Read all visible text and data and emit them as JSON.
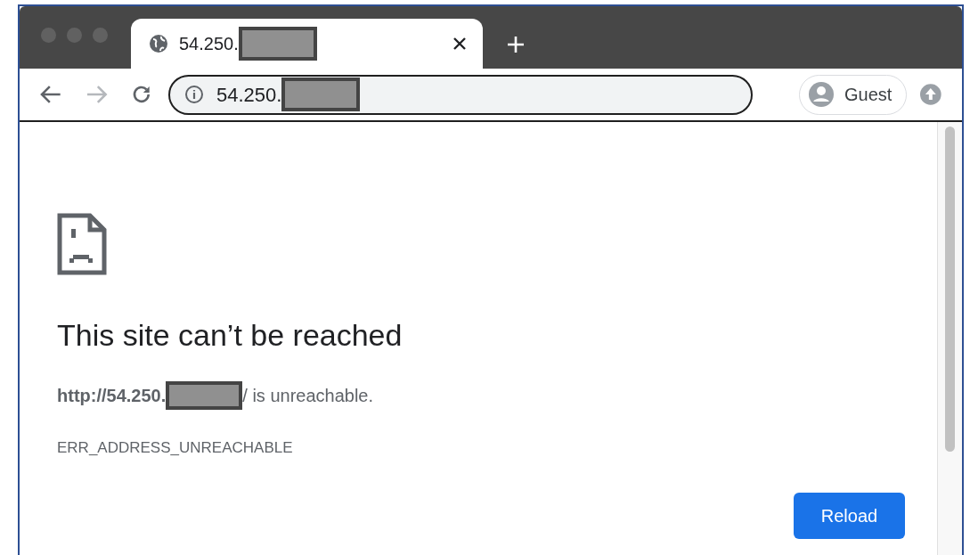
{
  "tabs": [
    {
      "title": "54.250.",
      "selected": true
    }
  ],
  "address_bar": {
    "url": "54.250."
  },
  "profile": {
    "label": "Guest"
  },
  "error": {
    "heading": "This site can’t be reached",
    "url": "http://54.250.",
    "message": "/ is unreachable.",
    "code": "ERR_ADDRESS_UNREACHABLE"
  },
  "buttons": [
    "Reload"
  ]
}
